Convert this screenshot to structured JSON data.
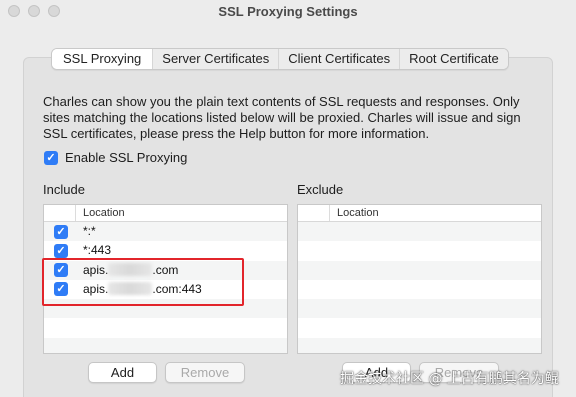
{
  "window": {
    "title": "SSL Proxying Settings"
  },
  "tabs": [
    {
      "label": "SSL Proxying",
      "active": true
    },
    {
      "label": "Server Certificates",
      "active": false
    },
    {
      "label": "Client Certificates",
      "active": false
    },
    {
      "label": "Root Certificate",
      "active": false
    }
  ],
  "description": "Charles can show you the plain text contents of SSL requests and responses. Only sites matching the locations listed below will be proxied. Charles will issue and sign SSL certificates, please press the Help button for more information.",
  "enable_ssl": {
    "label": "Enable SSL Proxying",
    "checked": true
  },
  "include": {
    "label": "Include",
    "column_header": "Location",
    "rows": [
      {
        "prefix": "*:*",
        "suffix": "",
        "redacted": false,
        "checked": true
      },
      {
        "prefix": "*:443",
        "suffix": "",
        "redacted": false,
        "checked": true
      },
      {
        "prefix": "apis.",
        "suffix": ".com",
        "redacted": true,
        "checked": true
      },
      {
        "prefix": "apis.",
        "suffix": ".com:443",
        "redacted": true,
        "checked": true
      }
    ],
    "add_label": "Add",
    "remove_label": "Remove"
  },
  "exclude": {
    "label": "Exclude",
    "column_header": "Location",
    "rows": [],
    "add_label": "Add",
    "remove_label": "Remove"
  },
  "watermark": "掘金技术社区 @ 上古有鹏其名为鲲",
  "colors": {
    "accent": "#2f7cf6",
    "highlight": "#e2252b"
  }
}
